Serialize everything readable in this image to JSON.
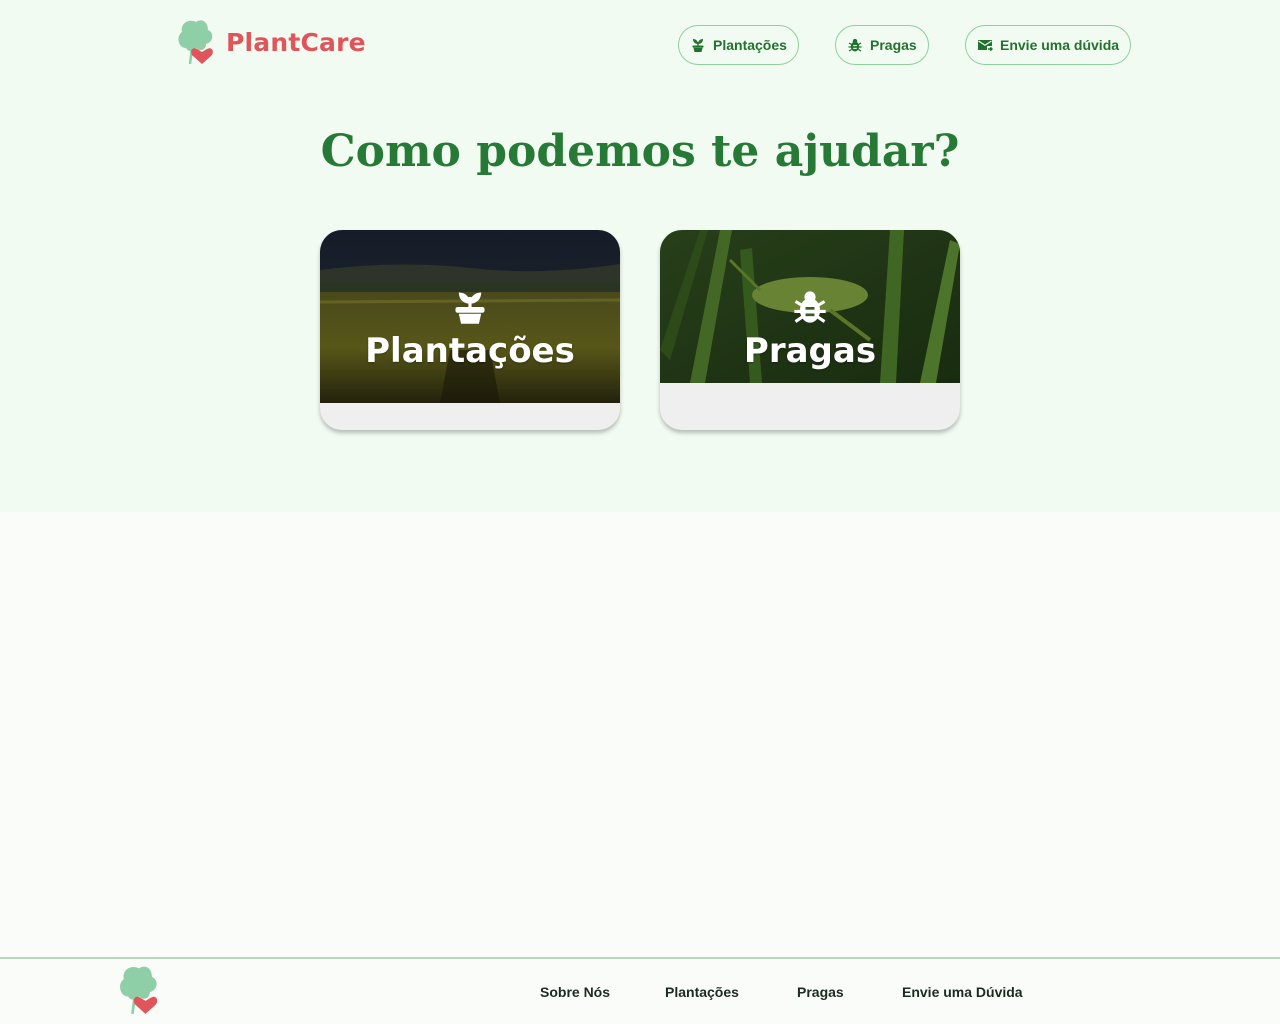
{
  "header": {
    "brand": "PlantCare",
    "nav": [
      {
        "label": "Plantações",
        "icon": "sprout-pot-icon"
      },
      {
        "label": "Pragas",
        "icon": "bug-icon"
      },
      {
        "label": "Envie uma dúvida",
        "icon": "mail-send-icon"
      }
    ]
  },
  "hero": {
    "title": "Como podemos te ajudar?"
  },
  "cards": [
    {
      "label": "Plantações",
      "icon": "sprout-pot-icon"
    },
    {
      "label": "Pragas",
      "icon": "bug-icon"
    }
  ],
  "footer": {
    "links": [
      "Sobre Nós",
      "Plantações",
      "Pragas",
      "Envie uma Dúvida"
    ]
  },
  "colors": {
    "brand": "#e0555b",
    "primary_green": "#267a36",
    "leaf_green": "#8fcfa8",
    "header_bg": "#f2fbf2"
  }
}
